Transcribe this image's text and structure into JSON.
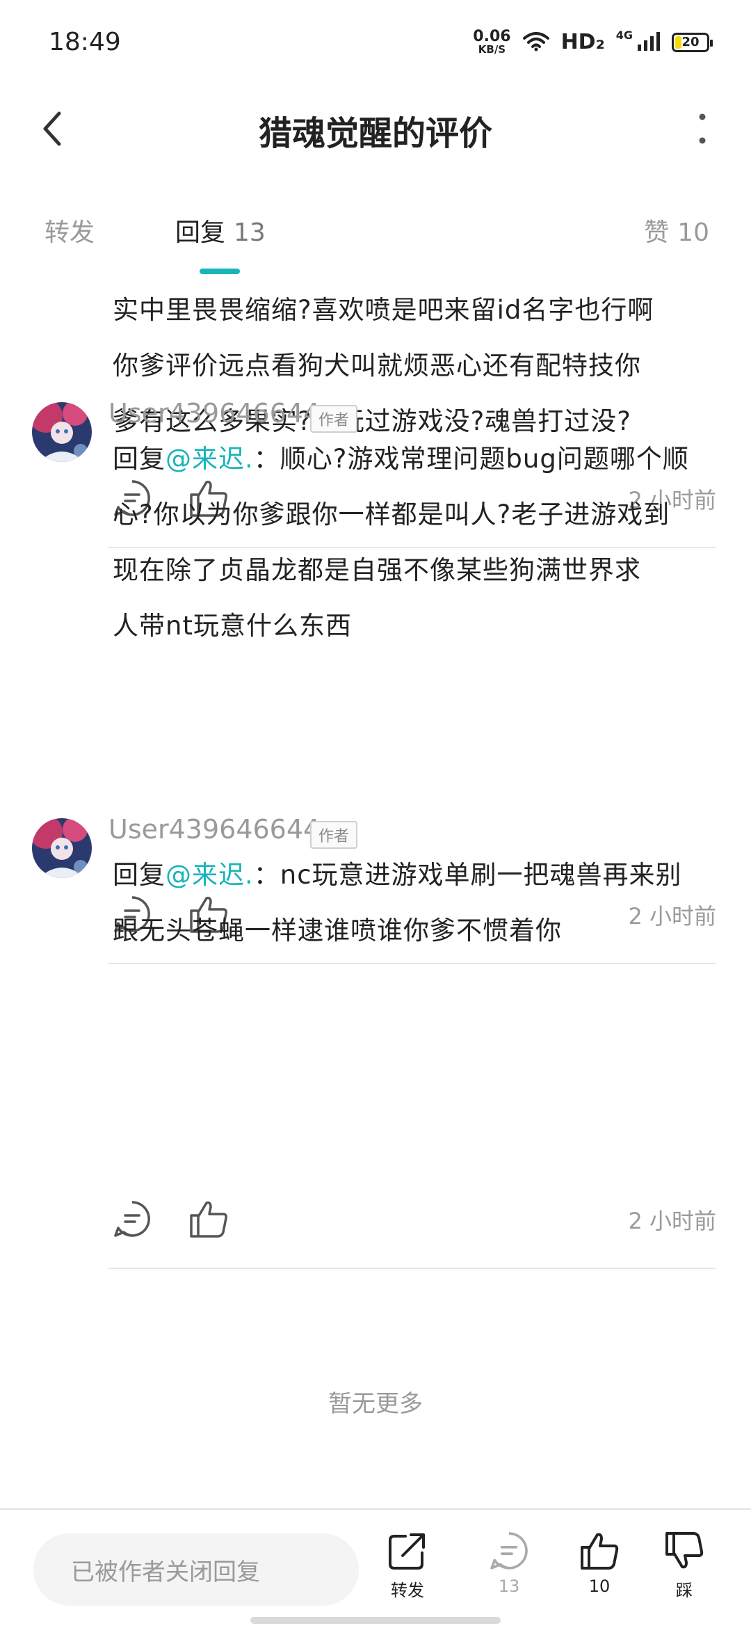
{
  "status_bar": {
    "time": "18:49",
    "net_speed_value": "0.06",
    "net_speed_unit": "KB/S",
    "hd_label": "HD₂",
    "network_label": "4G",
    "battery_level": "20",
    "battery_color": "#f5d90a"
  },
  "header": {
    "title": "猎魂觉醒的评价"
  },
  "tabs": {
    "forward_label": "转发",
    "reply_label": "回复",
    "reply_count": "13",
    "like_label": "赞",
    "like_count": "10",
    "accent_color": "#17b5ba"
  },
  "comments": [
    {
      "lines": [
        "实中里畏畏缩缩?喜欢喷是吧来留id名字也行啊",
        "你爹评价远点看狗犬叫就烦恶心还有配特技你",
        "爹有这么多果实?你玩过游戏没?魂兽打过没?"
      ],
      "time": "2 小时前"
    },
    {
      "user": "User439646644",
      "badge": "作者",
      "reply_prefix": "回复",
      "mention": "@来迟.",
      "lines": [
        "：顺心?游戏常理问题bug问题哪个顺",
        "心?你以为你爹跟你一样都是叫人?老子进游戏到",
        "现在除了贞晶龙都是自强不像某些狗满世界求",
        "人带nt玩意什么东西"
      ],
      "time": "2 小时前"
    },
    {
      "user": "User439646644",
      "badge": "作者",
      "reply_prefix": "回复",
      "mention": "@来迟.",
      "lines": [
        "：nc玩意进游戏单刷一把魂兽再来别",
        "跟无头苍蝇一样逮谁喷谁你爹不惯着你"
      ],
      "time": "2 小时前"
    }
  ],
  "no_more_text": "暂无更多",
  "bottom_bar": {
    "reply_placeholder": "已被作者关闭回复",
    "forward_label": "转发",
    "comment_count": "13",
    "like_count": "10",
    "dislike_label": "踩"
  },
  "icons": {
    "back": "chevron-left-icon",
    "more": "more-vertical-icon",
    "comment": "comment-icon",
    "like": "thumbs-up-icon",
    "dislike": "thumbs-down-icon",
    "share": "share-icon",
    "wifi": "wifi-icon",
    "signal": "signal-icon",
    "battery": "battery-icon"
  }
}
